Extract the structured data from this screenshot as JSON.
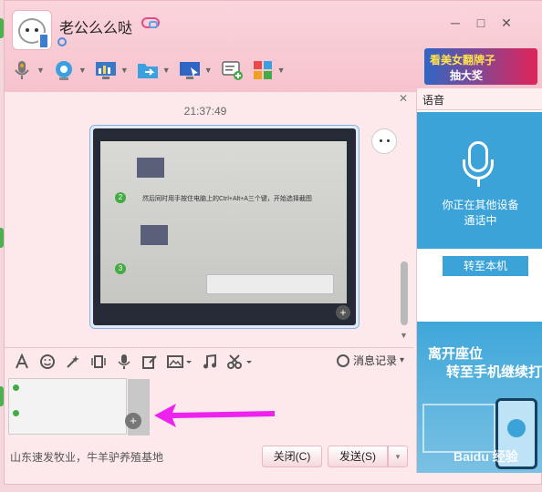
{
  "window": {
    "contact_name": "老公么么哒",
    "minimize": "─",
    "maximize": "□",
    "close": "✕"
  },
  "ad_banner": {
    "line1": "看美女翻牌子",
    "line2": "抽大奖"
  },
  "chat": {
    "close_glyph": "✕",
    "timestamp": "21:37:49",
    "screenshot_text": "然后同时用手按住电脑上的Ctrl+Alt+A三个键，开始选择截图",
    "photo_zoom": "+"
  },
  "input_toolbar": {
    "history_label": "消息记录",
    "history_caret": "▾",
    "icons": [
      "font-icon",
      "emoji-icon",
      "magic-icon",
      "shake-icon",
      "voice-icon",
      "edit-icon",
      "image-icon",
      "music-icon",
      "scissors-icon"
    ]
  },
  "input": {
    "thumb_zoom": "+"
  },
  "bottom": {
    "ad_text": "山东速发牧业，牛羊驴养殖基地",
    "close_button": "关闭(C)",
    "send_button": "发送(S)",
    "send_arrow": "▾"
  },
  "right_panel": {
    "tab_label": "语音",
    "status_line1": "你正在其他设备",
    "status_line2": "通话中",
    "transfer_button": "转至本机",
    "promo_line1": "离开座位",
    "promo_line2": "转至手机继续打",
    "watermark": "Baidu 经验"
  },
  "colors": {
    "accent_blue": "#3ba3d8",
    "title_pink": "#f6c3cd",
    "arrow_magenta": "#ee22ee"
  }
}
